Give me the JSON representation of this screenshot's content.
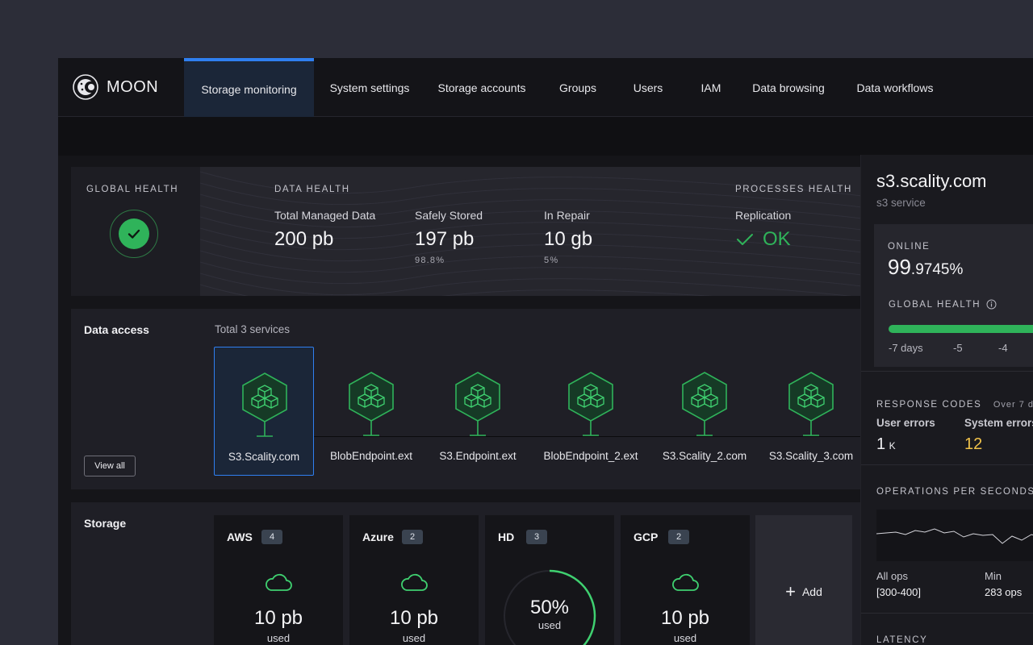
{
  "app": {
    "name": "MOON"
  },
  "nav": {
    "items": [
      {
        "label": "Storage monitoring",
        "active": true
      },
      {
        "label": "System settings"
      },
      {
        "label": "Storage accounts"
      },
      {
        "label": "Groups"
      },
      {
        "label": "Users"
      },
      {
        "label": "IAM"
      },
      {
        "label": "Data browsing"
      },
      {
        "label": "Data workflows"
      }
    ]
  },
  "global_health": {
    "label": "GLOBAL HEALTH",
    "status": "ok"
  },
  "data_health": {
    "label": "DATA HEALTH",
    "metrics": [
      {
        "label": "Total Managed Data",
        "value": "200 pb",
        "sub": ""
      },
      {
        "label": "Safely Stored",
        "value": "197 pb",
        "sub": "98.8%"
      },
      {
        "label": "In Repair",
        "value": "10 gb",
        "sub": "5%"
      }
    ]
  },
  "processes_health": {
    "label": "PROCESSES HEALTH",
    "replication_label": "Replication",
    "replication_status": "OK"
  },
  "data_access": {
    "title": "Data access",
    "total": "Total 3 services",
    "view_all": "View all",
    "services": [
      {
        "name": "S3.Scality.com",
        "selected": true
      },
      {
        "name": "BlobEndpoint.ext"
      },
      {
        "name": "S3.Endpoint.ext"
      },
      {
        "name": "BlobEndpoint_2.ext"
      },
      {
        "name": "S3.Scality_2.com"
      },
      {
        "name": "S3.Scality_3.com"
      }
    ]
  },
  "storage": {
    "title": "Storage",
    "cards": [
      {
        "name": "AWS",
        "count": "4",
        "value": "10 pb",
        "used": "used",
        "kind": "cloud"
      },
      {
        "name": "Azure",
        "count": "2",
        "value": "10 pb",
        "used": "used",
        "kind": "cloud"
      },
      {
        "name": "HD",
        "count": "3",
        "value": "50%",
        "used": "used",
        "kind": "gauge",
        "percent": 0.5
      },
      {
        "name": "GCP",
        "count": "2",
        "value": "10 pb",
        "used": "used",
        "kind": "cloud"
      }
    ],
    "add_label": "Add"
  },
  "side": {
    "host": "s3.scality.com",
    "service": "s3 service",
    "online_label": "ONLINE",
    "online_int": "99",
    "online_dec": ".9745%",
    "global_health_label": "GLOBAL HEALTH",
    "days": [
      "-7 days",
      "-5",
      "-4"
    ],
    "response_codes_label": "RESPONSE CODES",
    "response_period": "Over 7 d",
    "user_errors_label": "User errors",
    "user_errors_value": "1",
    "user_errors_unit": "K",
    "system_errors_label": "System errors",
    "system_errors_value": "12",
    "ops_label": "OPERATIONS PER SECONDS",
    "all_ops_label": "All ops",
    "all_ops_value": "[300-400]",
    "min_label": "Min",
    "min_value": "283 ops",
    "latency_label": "LATENCY"
  },
  "colors": {
    "accent": "#2f7ff0",
    "ok": "#2fb35a",
    "warn": "#f0c24a"
  }
}
